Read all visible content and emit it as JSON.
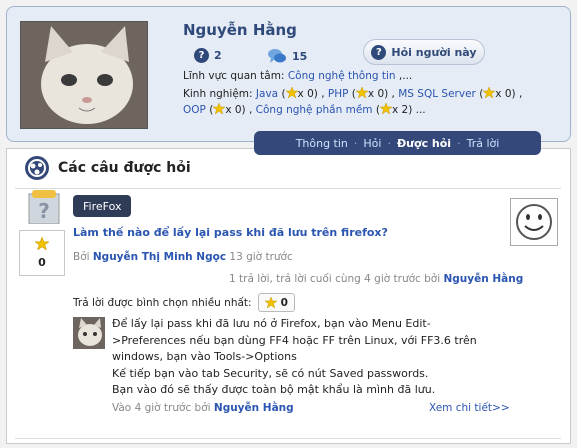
{
  "profile": {
    "name": "Nguyễn Hằng",
    "questions_count": "2",
    "answers_count": "15",
    "ask_button": "Hỏi người này",
    "interest_label": "Lĩnh vực quan tâm:",
    "interest_value": "Công nghệ thông tin",
    "interest_more": ",...",
    "experience_label": "Kinh nghiệm:",
    "skills": [
      {
        "name": "Java",
        "count": "x 0"
      },
      {
        "name": "PHP",
        "count": "x 0"
      },
      {
        "name": "MS SQL Server",
        "count": "x 0"
      },
      {
        "name": "OOP",
        "count": "x 0"
      },
      {
        "name": "Công nghệ phần mềm",
        "count": "x 2"
      }
    ],
    "skills_more": "..."
  },
  "tabs": [
    "Thông tin",
    "Hỏi",
    "Được hỏi",
    "Trả lời"
  ],
  "active_tab": "Được hỏi",
  "panel": {
    "title": "Các câu được hỏi"
  },
  "question": {
    "tag": "FireFox",
    "title": "Làm thế nào để lấy lại pass khi đã lưu trên firefox?",
    "votes": "0",
    "by_label": "Bởi",
    "author": "Nguyễn Thị Minh Ngọc",
    "time": "13 giờ trước",
    "replies_text": "1 trả lời, trả lời cuối cùng 4 giờ trước bởi",
    "last_replier": "Nguyễn Hằng",
    "best_label": "Trả lời được bình chọn nhiều nhất:",
    "best_votes": "0"
  },
  "answer": {
    "lines": [
      "Để lấy lại pass khi đã lưu nó ở Firefox, bạn vào Menu Edit-",
      ">Preferences nếu bạn dùng FF4 hoặc FF trên Linux, với FF3.6 trên",
      "windows, bạn vào Tools->Options",
      "Kế tiếp bạn vào tab Security, sẽ có nút Saved passwords.",
      "Bạn vào đó sẽ thấy được toàn bộ mật khẩu là mình đã lưu."
    ],
    "footer": "Vào 4 giờ trước bởi",
    "author": "Nguyễn Hằng",
    "more": "Xem chi tiết>>"
  },
  "colors": {
    "accent": "#2f4a7a",
    "link": "#2a55b0",
    "star": "#f2c200"
  }
}
